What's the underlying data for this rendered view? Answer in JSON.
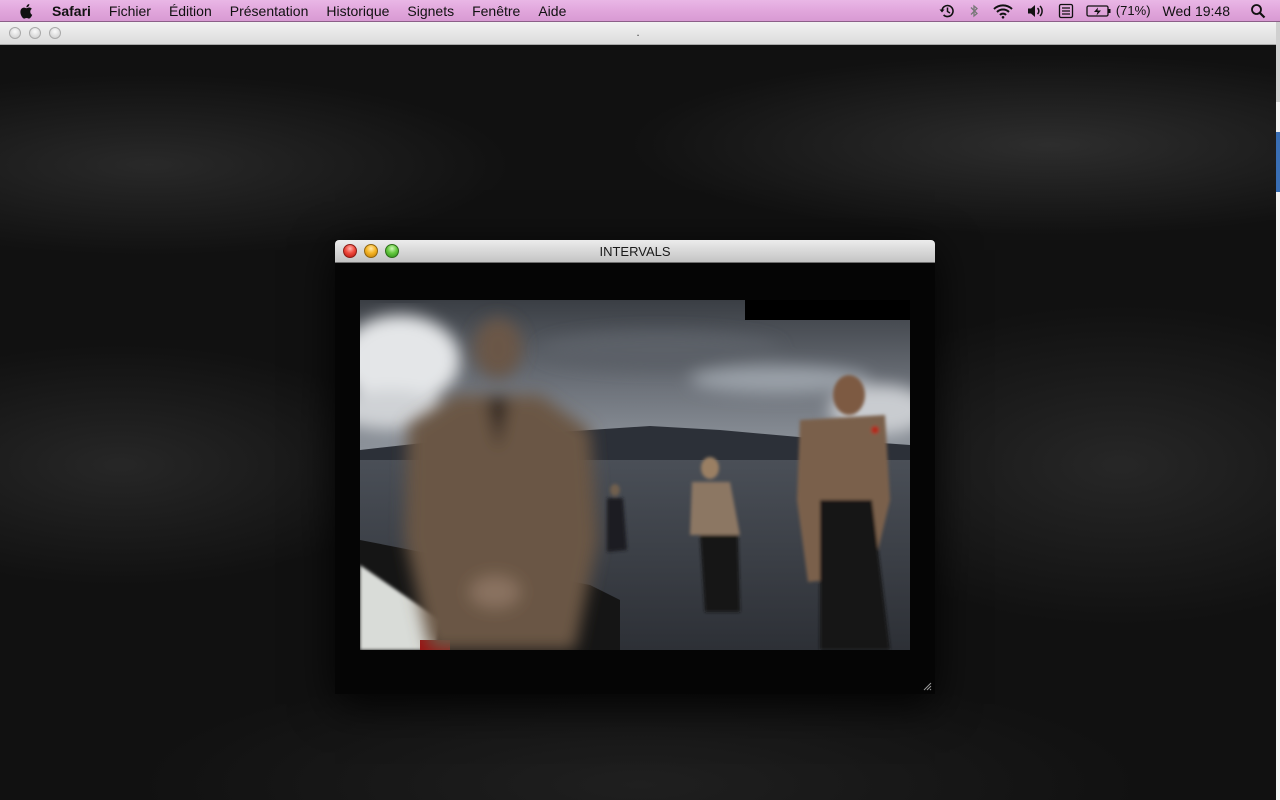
{
  "menubar": {
    "app_name": "Safari",
    "items": [
      "Fichier",
      "Édition",
      "Présentation",
      "Historique",
      "Signets",
      "Fenêtre",
      "Aide"
    ],
    "status": {
      "battery_percent": "(71%)",
      "clock": "Wed 19:48",
      "icons": [
        "time-machine-icon",
        "bluetooth-icon",
        "wifi-icon",
        "volume-icon",
        "keyboard-input-icon",
        "battery-icon",
        "spotlight-icon"
      ]
    }
  },
  "safari_window": {
    "title": "."
  },
  "intervals_window": {
    "title": "INTERVALS"
  },
  "colors": {
    "menubar": "#e2a8dd",
    "close": "#ef4b3f",
    "minimize": "#f5b526",
    "zoom": "#65c93f"
  }
}
